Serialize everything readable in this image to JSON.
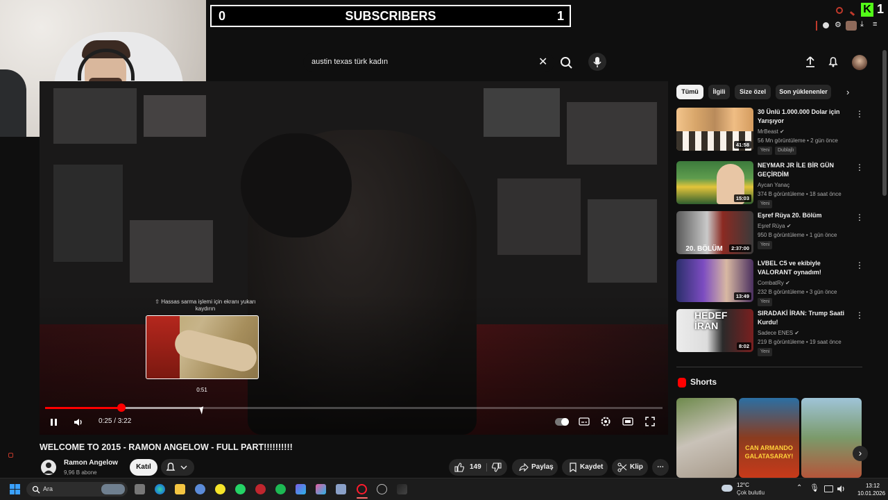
{
  "overlay": {
    "sub_left": "0",
    "sub_title": "SUBSCRIBERS",
    "sub_right": "1",
    "kick_logo": "K",
    "kick_count": "1"
  },
  "search": {
    "query": "austin texas türk kadın"
  },
  "player": {
    "preview_hint": "⇧ Hassas sarma işlemi için ekranı yukarı kaydırın",
    "preview_time": "0:51",
    "time_display": "0:25 / 3:22",
    "progress_fraction": 0.124,
    "buffered_fraction": 0.252
  },
  "video": {
    "title": "WELCOME TO 2015 - RAMON ANGELOW - FULL PART!!!!!!!!!!",
    "channel_name": "Ramon Angelow",
    "channel_subs": "9,96 B abone",
    "join_label": "Katıl",
    "likes": "149",
    "share_label": "Paylaş",
    "save_label": "Kaydet",
    "clip_label": "Klip"
  },
  "chips": [
    "Tümü",
    "İlgili",
    "Size özel",
    "Son yüklenenler"
  ],
  "recommendations": [
    {
      "title": "30 Ünlü 1.000.000 Dolar için Yarışıyor",
      "channel": "MrBeast",
      "meta": "56 Mn görüntüleme • 2 gün önce",
      "duration": "41:58",
      "badges": [
        "Yeni",
        "Dublajlı"
      ]
    },
    {
      "title": "NEYMAR JR İLE BİR GÜN GEÇİRDİM",
      "channel": "Aycan Yanaç",
      "meta": "374 B görüntüleme • 18 saat önce",
      "duration": "15:03",
      "badges": [
        "Yeni"
      ]
    },
    {
      "title": "Eşref Rüya 20. Bölüm",
      "channel": "Eşref Rüya",
      "meta": "950 B görüntüleme • 1 gün önce",
      "duration": "2:37:00",
      "thumb_text": "20. BÖLÜM",
      "badges": [
        "Yeni"
      ]
    },
    {
      "title": "LVBEL C5 ve ekibiyle VALORANT oynadım!",
      "channel": "CombatRy",
      "meta": "232 B görüntüleme • 3 gün önce",
      "duration": "13:49",
      "badges": [
        "Yeni"
      ]
    },
    {
      "title": "SIRADAKİ İRAN: Trump Saati Kurdu!",
      "channel": "Sadece ENES",
      "meta": "219 B görüntüleme • 19 saat önce",
      "duration": "8:02",
      "thumb_text": "HEDEF İRAN",
      "badges": [
        "Yeni"
      ]
    }
  ],
  "shorts": {
    "heading": "Shorts",
    "short2_text": "CAN ARMANDO GALATASARAY!"
  },
  "taskbar": {
    "search_label": "Ara",
    "weather_temp": "12°C",
    "weather_desc": "Çok bulutlu",
    "time": "13:12",
    "date": "10.01.2026"
  },
  "colors": {
    "accent": "#ff0000",
    "bg": "#0f0f0f",
    "kick": "#53fc18"
  }
}
